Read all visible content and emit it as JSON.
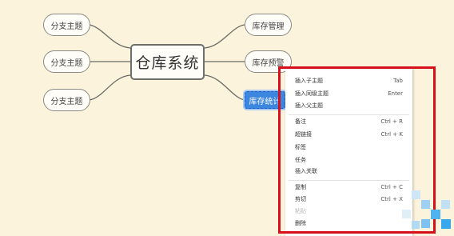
{
  "central": {
    "label": "仓库系统"
  },
  "left_branches": [
    {
      "label": "分支主题"
    },
    {
      "label": "分支主题"
    },
    {
      "label": "分支主题"
    }
  ],
  "right_branches": [
    {
      "label": "库存管理"
    },
    {
      "label": "库存预警"
    },
    {
      "label": "库存统计"
    }
  ],
  "context_menu": {
    "items": [
      {
        "label": "插入子主题",
        "shortcut": "Tab"
      },
      {
        "label": "插入同级主题",
        "shortcut": "Enter"
      },
      {
        "label": "插入父主题",
        "shortcut": ""
      },
      {
        "label": "备注",
        "shortcut": "Ctrl + R"
      },
      {
        "label": "超链接",
        "shortcut": "Ctrl + K"
      },
      {
        "label": "标签",
        "shortcut": ""
      },
      {
        "label": "任务",
        "shortcut": ""
      },
      {
        "label": "插入关联",
        "shortcut": ""
      },
      {
        "label": "复制",
        "shortcut": "Ctrl + C"
      },
      {
        "label": "剪切",
        "shortcut": "Ctrl + X"
      },
      {
        "label": "粘贴",
        "shortcut": ""
      },
      {
        "label": "删除",
        "shortcut": ""
      }
    ]
  },
  "colors": {
    "canvas": "#fbf3dc",
    "highlight_box": "#d6101b",
    "selection": "#3d86e0",
    "watermark": "#4fb3f0"
  }
}
